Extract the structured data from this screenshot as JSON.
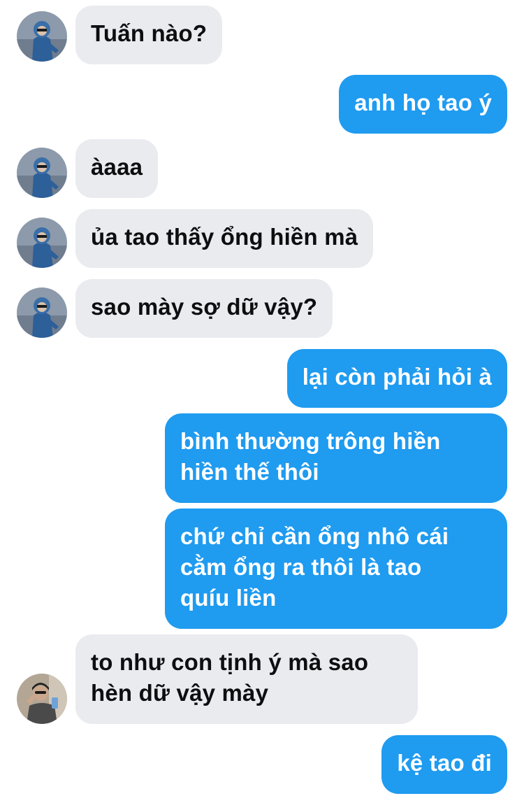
{
  "contacts": {
    "friend_a": {
      "avatar_icon": "avatar-blue-hoodie-icon",
      "bg": "#7b8fa6"
    },
    "friend_b": {
      "avatar_icon": "avatar-person-photo-icon",
      "bg": "#a89b8b"
    }
  },
  "colors": {
    "incoming_bubble": "#e9ebef",
    "outgoing_bubble": "#1f9bf0",
    "incoming_text": "#0e0e10",
    "outgoing_text": "#ffffff"
  },
  "messages": [
    {
      "direction": "in",
      "sender": "friend_a",
      "text": "Tuấn nào?"
    },
    {
      "direction": "out",
      "text": "anh họ tao ý"
    },
    {
      "direction": "in",
      "sender": "friend_a",
      "text": "àaaa"
    },
    {
      "direction": "in",
      "sender": "friend_a",
      "text": "ủa tao thấy ổng hiền mà"
    },
    {
      "direction": "in",
      "sender": "friend_a",
      "text": "sao mày sợ dữ vậy?"
    },
    {
      "direction": "out",
      "text": "lại còn phải hỏi à"
    },
    {
      "direction": "out",
      "text": "bình thường trông hiền\nhiền thế thôi"
    },
    {
      "direction": "out",
      "text": "chứ chỉ cần ổng nhô cái\ncằm ổng ra thôi là tao\nquíu liền"
    },
    {
      "direction": "in",
      "sender": "friend_b",
      "text": "to như con tịnh ý mà sao\nhèn dữ vậy mày"
    },
    {
      "direction": "out",
      "text": "kệ tao đi"
    }
  ]
}
